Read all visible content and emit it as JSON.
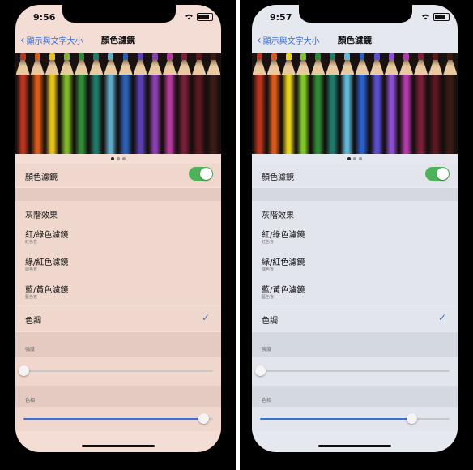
{
  "screens": [
    {
      "time": "9:56",
      "back_label": "顯示與文字大小",
      "title": "顏色濾鏡",
      "filter_toggle_label": "顏色濾鏡",
      "filter_toggle_on": true,
      "options": [
        {
          "label": "灰階效果",
          "sub": ""
        },
        {
          "label": "紅/綠色濾鏡",
          "sub": "紅色盲"
        },
        {
          "label": "綠/紅色濾鏡",
          "sub": "綠色盲"
        },
        {
          "label": "藍/黃色濾鏡",
          "sub": "藍色盲"
        },
        {
          "label": "色調",
          "sub": "",
          "selected": true
        }
      ],
      "intensity_label": "強度",
      "intensity_value": 0.0,
      "hue_label": "色相",
      "hue_value": 0.95
    },
    {
      "time": "9:57",
      "back_label": "顯示與文字大小",
      "title": "顏色濾鏡",
      "filter_toggle_label": "顏色濾鏡",
      "filter_toggle_on": true,
      "options": [
        {
          "label": "灰階效果",
          "sub": ""
        },
        {
          "label": "紅/綠色濾鏡",
          "sub": "紅色盲"
        },
        {
          "label": "綠/紅色濾鏡",
          "sub": "綠色盲"
        },
        {
          "label": "藍/黃色濾鏡",
          "sub": "藍色盲"
        },
        {
          "label": "色調",
          "sub": "",
          "selected": true
        }
      ],
      "intensity_label": "強度",
      "intensity_value": 0.0,
      "hue_label": "色相",
      "hue_value": 0.8
    }
  ],
  "colors": {
    "accent": "#3b6fd8",
    "toggle_on": "#4fb15a",
    "pencils_left": [
      "#b8341f",
      "#d95a1a",
      "#e8c21c",
      "#7fb62a",
      "#2f8a36",
      "#1f7a6a",
      "#5fa8c8",
      "#2a5fb8",
      "#5a3fae",
      "#8a3fb0",
      "#b23a9a",
      "#7a1f3a",
      "#5a1820",
      "#3a1a14"
    ],
    "pencils_right": [
      "#b8341f",
      "#d95a1a",
      "#e8d21c",
      "#7fc62a",
      "#2f8a36",
      "#1f7a6a",
      "#5fb8d8",
      "#2a5fc8",
      "#5a4fce",
      "#8a4fd0",
      "#b23aaa",
      "#7a1f3a",
      "#5a1820",
      "#3a1a14"
    ]
  },
  "icons": [
    "chevron-left-icon",
    "wifi-icon",
    "battery-icon",
    "checkmark-icon"
  ]
}
